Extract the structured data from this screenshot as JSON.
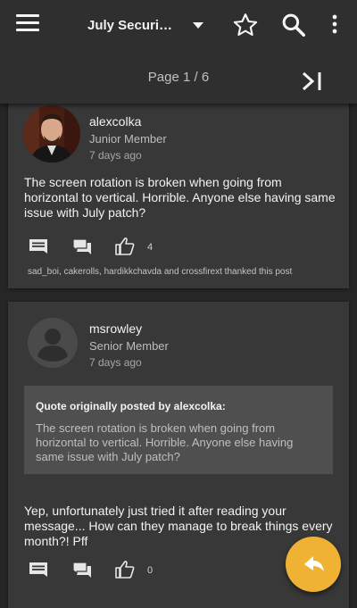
{
  "header": {
    "title": "July Securi…",
    "icons": [
      "menu-icon",
      "dropdown-caret-icon",
      "star-outline-icon",
      "search-icon",
      "more-vert-icon"
    ]
  },
  "pagination": {
    "label": "Page 1 / 6",
    "last_icon": "last-page-icon"
  },
  "posts": [
    {
      "username": "alexcolka",
      "rank": "Junior Member",
      "date": "7 days ago",
      "body": "The screen rotation is broken when going from horizontal to vertical. Horrible. Anyone else having same issue with July patch?",
      "likes": "4",
      "thanks": "sad_boi, cakerolls, hardikkchavda and crossfirext thanked this post"
    },
    {
      "username": "msrowley",
      "rank": "Senior Member",
      "date": "7 days ago",
      "quote_header": "Quote originally posted by alexcolka:",
      "quote_body": "The screen rotation is broken when going from horizontal to vertical. Horrible. Anyone else having same issue with July patch?",
      "body": "Yep, unfortunately just tried it after reading your message... How can they manage to break things every month?! Pff",
      "likes": "0"
    }
  ],
  "fab": {
    "icon": "reply-icon"
  },
  "colors": {
    "accent": "#f0b233",
    "header_bg": "#2f2f2f",
    "card_bg": "#383838",
    "content_bg": "#262626",
    "quote_bg": "#4f4f4f"
  }
}
